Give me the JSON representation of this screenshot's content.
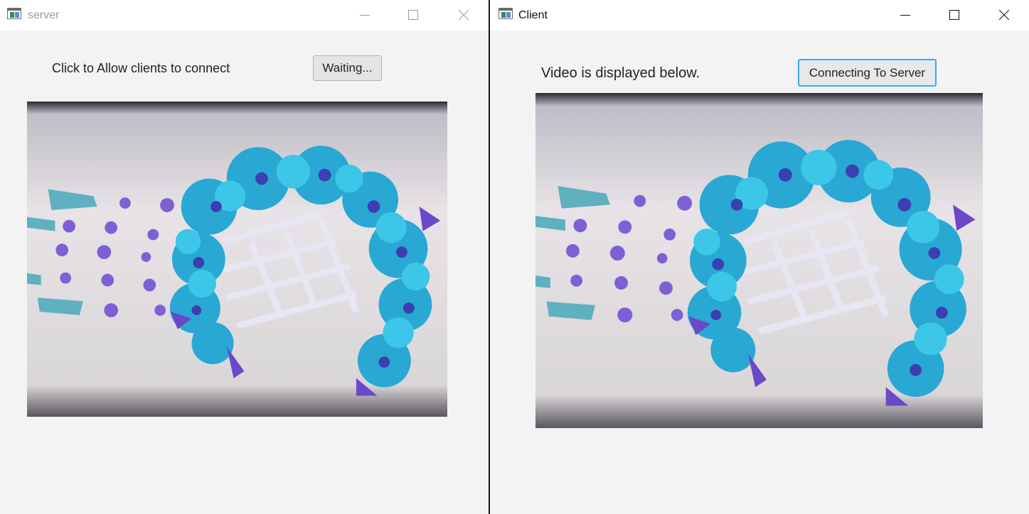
{
  "server": {
    "title": "server",
    "prompt_label": "Click to Allow clients to connect",
    "button_label": "Waiting...",
    "video_feed": "camera-frame-flower-arch-image"
  },
  "client": {
    "title": "Client",
    "prompt_label": "Video is displayed below.",
    "button_label": "Connecting To Server",
    "video_feed": "camera-frame-flower-arch-image"
  },
  "icons": {
    "app": "java-app-icon",
    "minimize": "minimize-icon",
    "maximize": "maximize-icon",
    "close": "close-icon"
  },
  "colors": {
    "focus_ring": "#3ba9e6",
    "window_bg": "#f3f3f3",
    "titlebar_bg": "#ffffff",
    "inactive_title": "#9a9a9a"
  }
}
